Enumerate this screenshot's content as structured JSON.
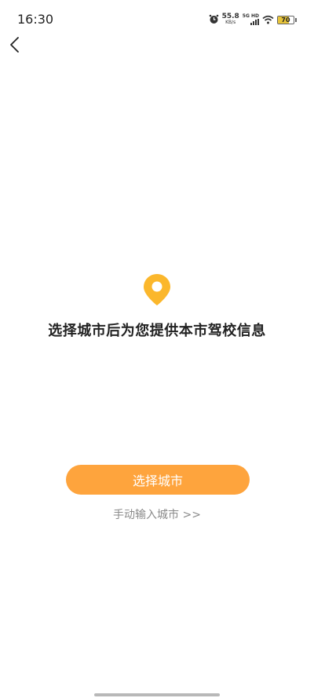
{
  "status_bar": {
    "time": "16:30",
    "net_speed_value": "55.8",
    "net_speed_unit": "KB/s",
    "network_label": "5G HD",
    "battery_level": "70",
    "icons": [
      "alarm-icon",
      "wifi-icon",
      "signal-icon",
      "battery-icon"
    ]
  },
  "nav": {
    "back_icon": "chevron-left-icon"
  },
  "main": {
    "icon": "location-pin-icon",
    "headline": "选择城市后为您提供本市驾校信息",
    "primary_button_label": "选择城市",
    "manual_link_label": "手动输入城市 >>"
  },
  "colors": {
    "accent": "#fea43d",
    "pin": "#fbb72c",
    "link": "#8a8a8a"
  }
}
